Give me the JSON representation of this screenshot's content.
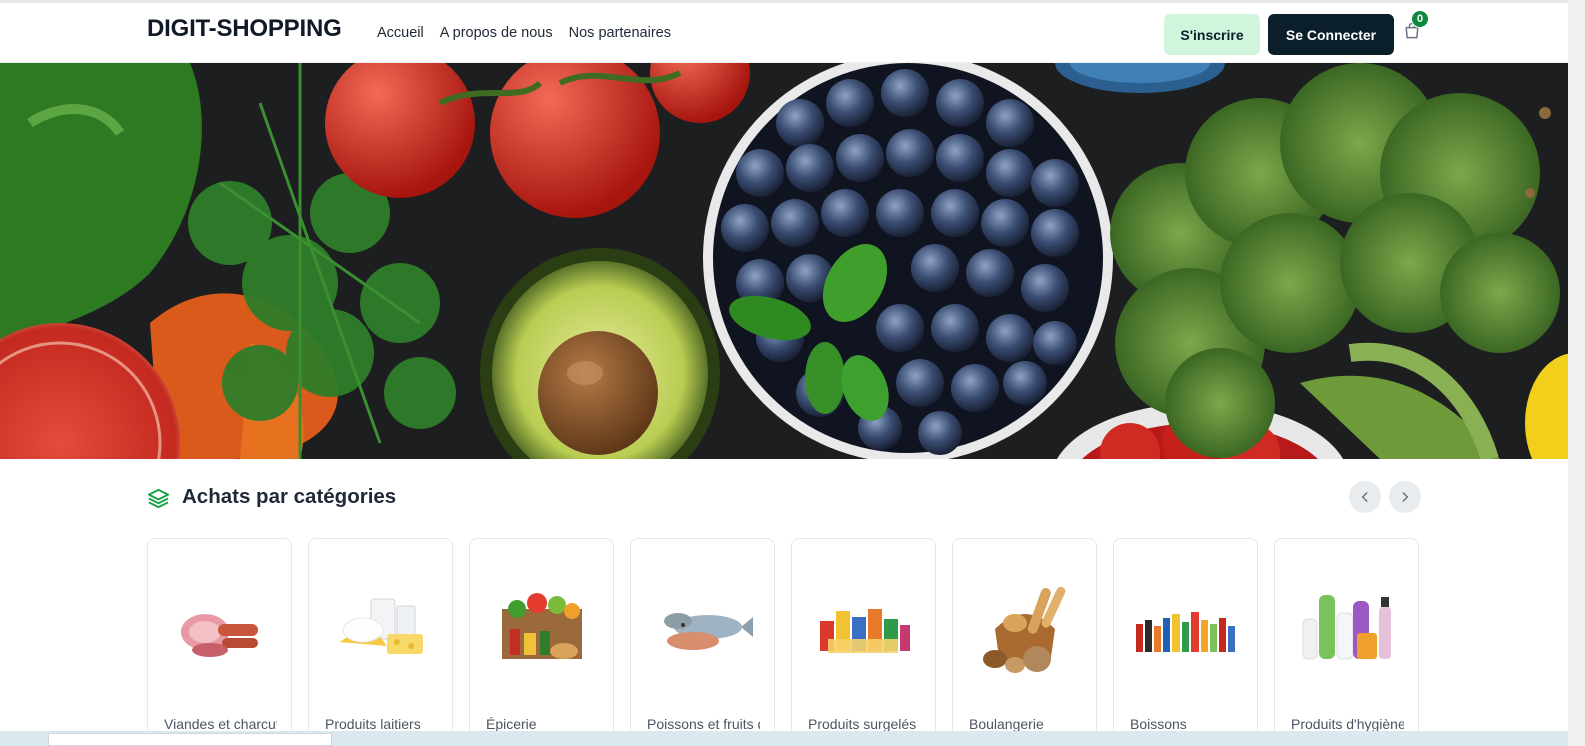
{
  "header": {
    "logo": "DIGIT-SHOPPING",
    "nav": [
      "Accueil",
      "A propos de nous",
      "Nos partenaires"
    ],
    "register_label": "S'inscrire",
    "login_label": "Se Connecter",
    "cart_count": "0"
  },
  "hero": {
    "image": "groceries-banner"
  },
  "categories": {
    "title": "Achats par catégories",
    "items": [
      {
        "label": "Viandes et charcuterie",
        "icon": "meat-icon"
      },
      {
        "label": "Produits laitiers",
        "icon": "dairy-icon"
      },
      {
        "label": "Épicerie",
        "icon": "grocery-icon"
      },
      {
        "label": "Poissons et fruits de mer",
        "icon": "fish-icon"
      },
      {
        "label": "Produits surgelés",
        "icon": "frozen-icon"
      },
      {
        "label": "Boulangerie",
        "icon": "bread-icon"
      },
      {
        "label": "Boissons",
        "icon": "drinks-icon"
      },
      {
        "label": "Produits d'hygiène",
        "icon": "hygiene-icon"
      }
    ]
  },
  "colors": {
    "accent_green": "#0b8a3e",
    "register_bg": "#d1f4dc",
    "login_bg": "#0b1f2a"
  }
}
